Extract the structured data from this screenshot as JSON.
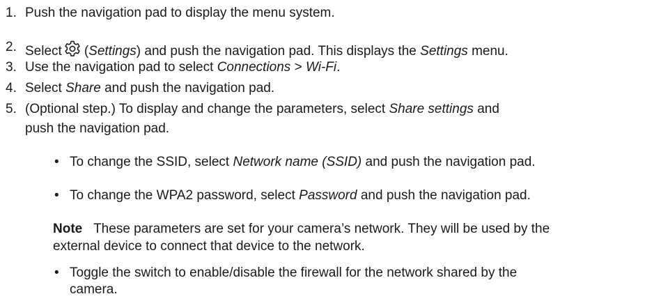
{
  "steps": [
    {
      "num": "1.",
      "parts": [
        "Push the navigation pad to display the menu system."
      ]
    },
    {
      "num": "2.",
      "a": "Select",
      "b": "(",
      "c": "Settings",
      "d": ") and push the navigation pad. This displays the ",
      "e": "Settings",
      "f": " menu."
    },
    {
      "num": "3.",
      "a": "Use the navigation pad to select ",
      "b": "Connections",
      "c": " > ",
      "d": "Wi-Fi",
      "e": "."
    },
    {
      "num": "4.",
      "a": "Select ",
      "b": "Share",
      "c": " and push the navigation pad."
    },
    {
      "num": "5.",
      "a": "(Optional step.) To display and change the parameters, select ",
      "b": "Share settings",
      "c": " and",
      "d": "push the navigation pad."
    }
  ],
  "bullets": [
    {
      "dot": "•",
      "a": "To change the SSID, select ",
      "b": "Network name (SSID)",
      "c": " and push the navigation pad."
    },
    {
      "dot": "•",
      "a": "To change the WPA2 password, select ",
      "b": "Password",
      "c": " and push the navigation pad."
    },
    {
      "dot": "•",
      "a": "Toggle the switch to enable/disable the firewall for the network shared by the",
      "b": "camera."
    }
  ],
  "note": {
    "label": "Note",
    "line1": "These parameters are set for your camera’s network. They will be used by the",
    "line2": "external device to connect that device to the network."
  },
  "icons": {
    "settings": "gear-icon"
  }
}
